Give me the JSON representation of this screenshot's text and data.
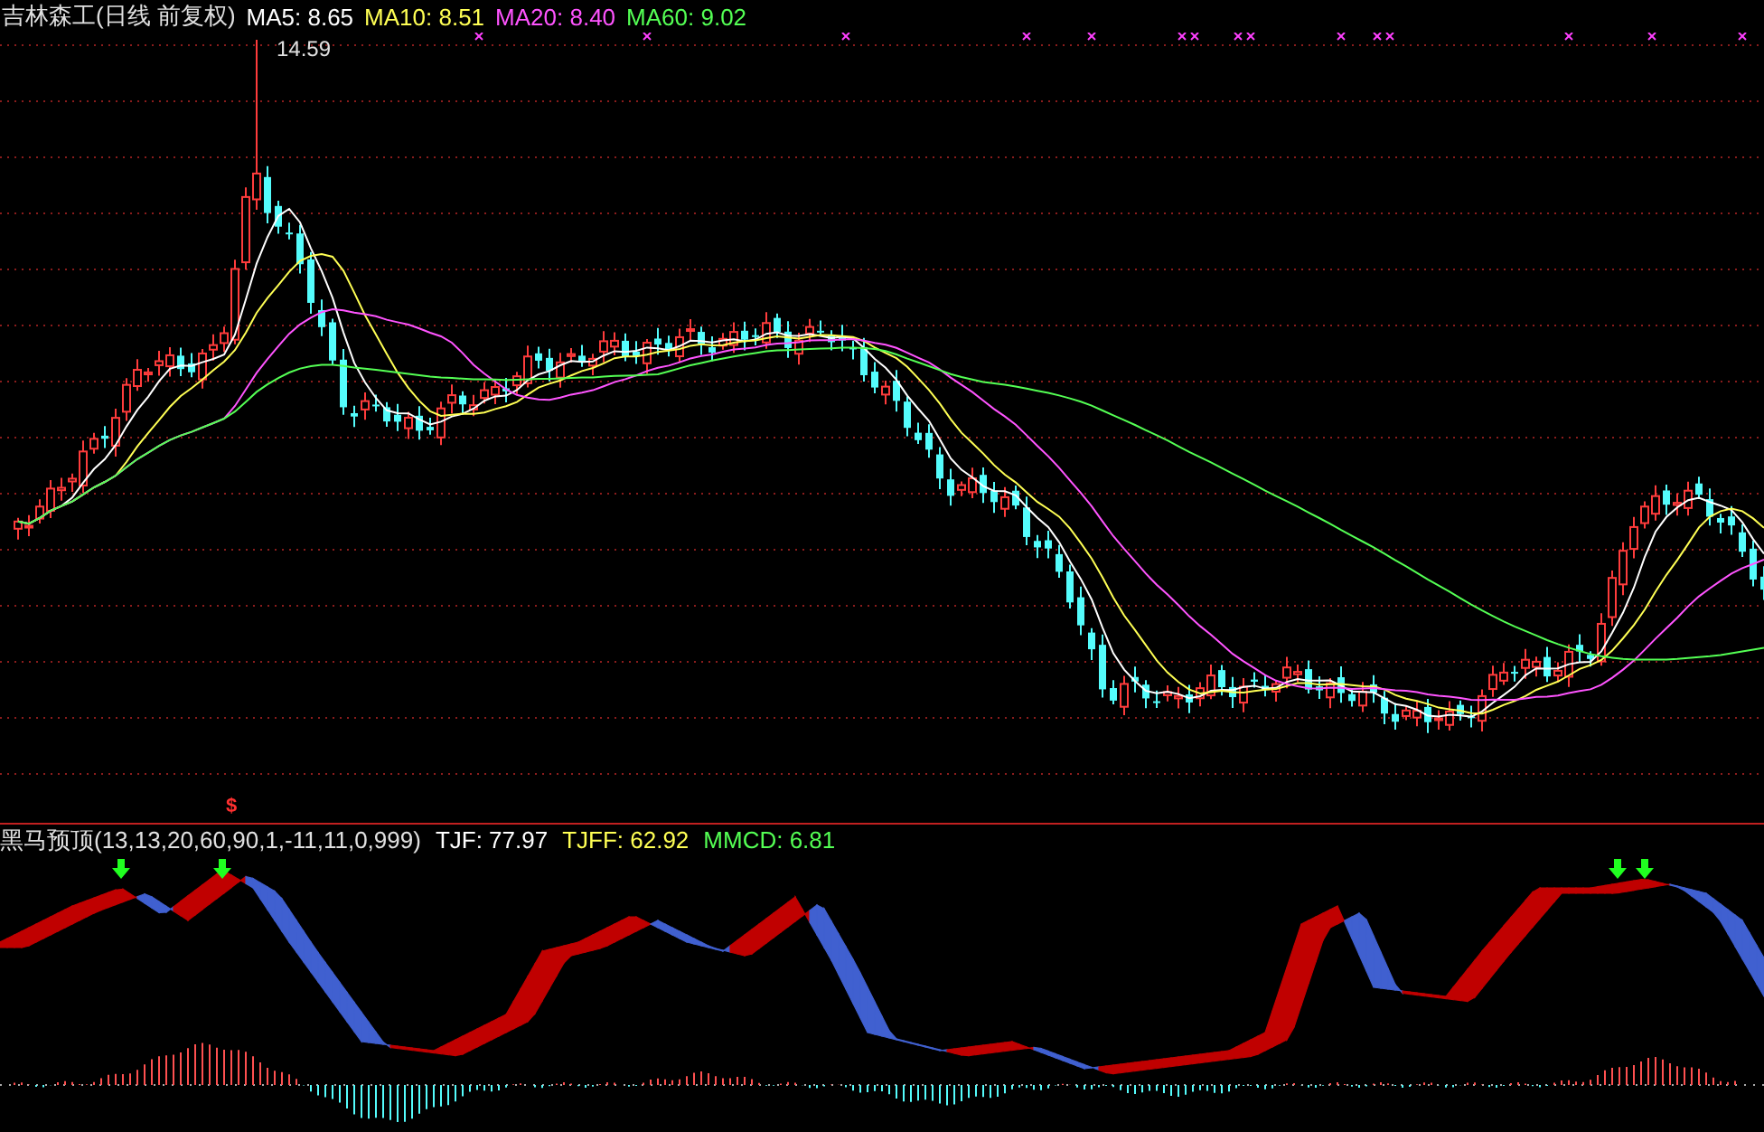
{
  "title": {
    "name": "吉林森工(日线 前复权)"
  },
  "moving_averages": [
    {
      "label": "MA5: 8.65",
      "color": "#ffffff"
    },
    {
      "label": "MA10: 8.51",
      "color": "#ffff54"
    },
    {
      "label": "MA20: 8.40",
      "color": "#ff54ff"
    },
    {
      "label": "MA60: 9.02",
      "color": "#54ff54"
    }
  ],
  "high_label": "14.59",
  "signal_marker": "$",
  "indicator": {
    "name": "黑马预顶(13,13,20,60,90,1,-11,11,0,999)",
    "values": [
      {
        "label": "TJF: 77.97",
        "color": "#ffffff"
      },
      {
        "label": "TJFF: 62.92",
        "color": "#ffff54"
      },
      {
        "label": "MMCD: 6.81",
        "color": "#54ff54"
      }
    ]
  }
}
